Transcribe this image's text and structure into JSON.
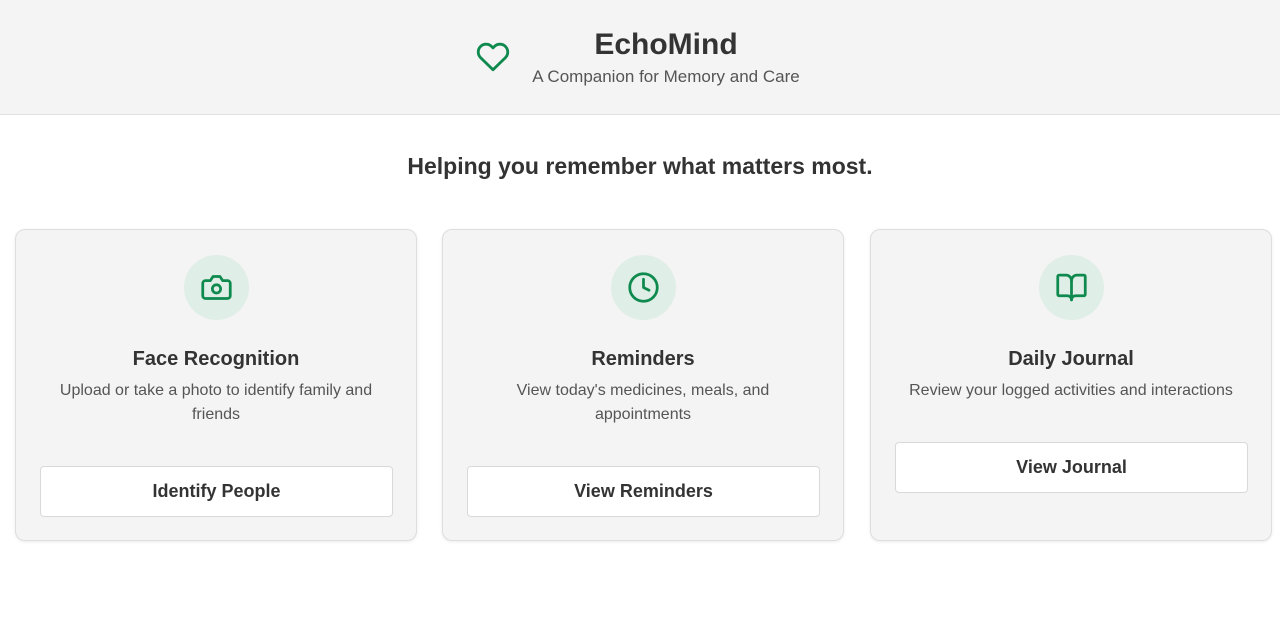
{
  "header": {
    "title": "EchoMind",
    "subtitle": "A Companion for Memory and Care",
    "icon": "heart-icon"
  },
  "tagline": "Helping you remember what matters most.",
  "colors": {
    "accent": "#0f8a4f",
    "icon_bg": "#dfeee6",
    "card_bg": "#f4f4f4",
    "header_bg": "#f4f4f4"
  },
  "cards": [
    {
      "icon": "camera-icon",
      "title": "Face Recognition",
      "description": "Upload or take a photo to identify family and friends",
      "button_label": "Identify People"
    },
    {
      "icon": "clock-icon",
      "title": "Reminders",
      "description": "View today's medicines, meals, and appointments",
      "button_label": "View Reminders"
    },
    {
      "icon": "book-open-icon",
      "title": "Daily Journal",
      "description": "Review your logged activities and interactions",
      "button_label": "View Journal"
    }
  ]
}
